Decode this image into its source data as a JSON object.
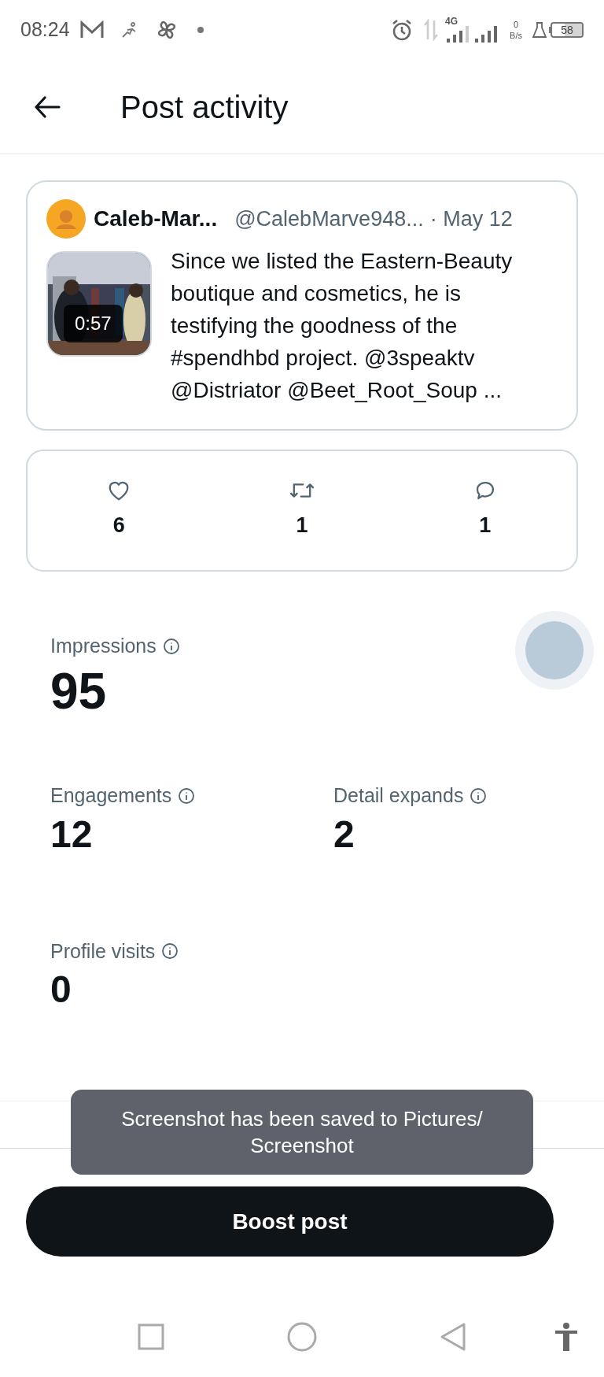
{
  "status_bar": {
    "time": "08:24",
    "network": "4G",
    "speed_value": "0",
    "speed_unit": "B/s",
    "battery": "58"
  },
  "header": {
    "title": "Post activity"
  },
  "post": {
    "author": "Caleb-Mar...",
    "handle": "@CalebMarve948...",
    "date": "· May 12",
    "video_duration": "0:57",
    "text": "Since we listed the Eastern-Beauty boutique and cosmetics, he is testifying the goodness of the #spendhbd project. @3speaktv @Distriator @Beet_Root_Soup ..."
  },
  "engagement": [
    {
      "kind": "like",
      "count": "6"
    },
    {
      "kind": "repost",
      "count": "1"
    },
    {
      "kind": "reply",
      "count": "1"
    }
  ],
  "metrics": [
    {
      "label": "Impressions",
      "value": "95",
      "kind": "headline"
    },
    {
      "label": "Engagements",
      "value": "12",
      "kind": "stat"
    },
    {
      "label": "Detail expands",
      "value": "2",
      "kind": "stat"
    },
    {
      "label": "Profile visits",
      "value": "0",
      "kind": "stat"
    }
  ],
  "toast": {
    "text": "Screenshot has been saved to  Pictures/ Screenshot"
  },
  "boost_button": {
    "label": "Boost post"
  }
}
